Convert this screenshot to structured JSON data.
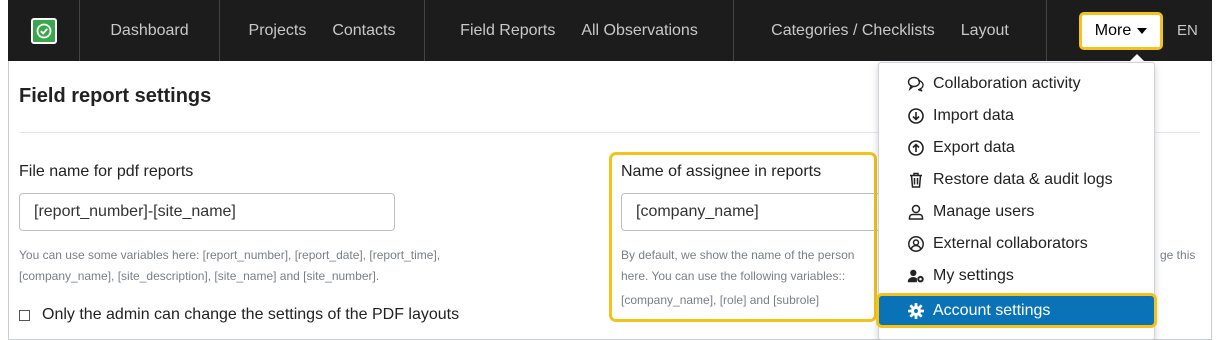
{
  "nav": {
    "links": [
      "Dashboard",
      "Projects",
      "Contacts",
      "Field Reports",
      "All Observations",
      "Categories / Checklists",
      "Layout"
    ],
    "more_label": "More",
    "lang": "EN"
  },
  "page": {
    "title": "Field report settings"
  },
  "pdf_name": {
    "label": "File name for pdf reports",
    "value": "[report_number]-[site_name]",
    "help_line1": "You can use some variables here: [report_number], [report_date], [report_time],",
    "help_line2": "[company_name], [site_description], [site_name] and [site_number]."
  },
  "assignee": {
    "label": "Name of assignee in reports",
    "value": "[company_name]",
    "help_line1": "By default, we show the name of the person",
    "help_line1_right": "ge this",
    "help_line2": "here. You can use the following variables::",
    "help_line3": "[company_name], [role] and [subrole]"
  },
  "checkbox": {
    "label": "Only the admin can change the settings of the PDF layouts"
  },
  "dropdown": {
    "items": [
      {
        "label": "Collaboration activity",
        "icon": "chat-bubbles-icon"
      },
      {
        "label": "Import data",
        "icon": "circle-arrow-down-icon"
      },
      {
        "label": "Export data",
        "icon": "circle-arrow-up-icon"
      },
      {
        "label": "Restore data & audit logs",
        "icon": "trash-icon"
      },
      {
        "label": "Manage users",
        "icon": "user-icon"
      },
      {
        "label": "External collaborators",
        "icon": "user-circle-icon"
      },
      {
        "label": "My settings",
        "icon": "user-gear-icon"
      },
      {
        "label": "Account settings",
        "icon": "gear-icon"
      }
    ],
    "active_color": "#0a73b8"
  },
  "colors": {
    "highlight": "#f3c319",
    "navbar": "#1c1c1c",
    "brand_green": "#3aa64b"
  }
}
